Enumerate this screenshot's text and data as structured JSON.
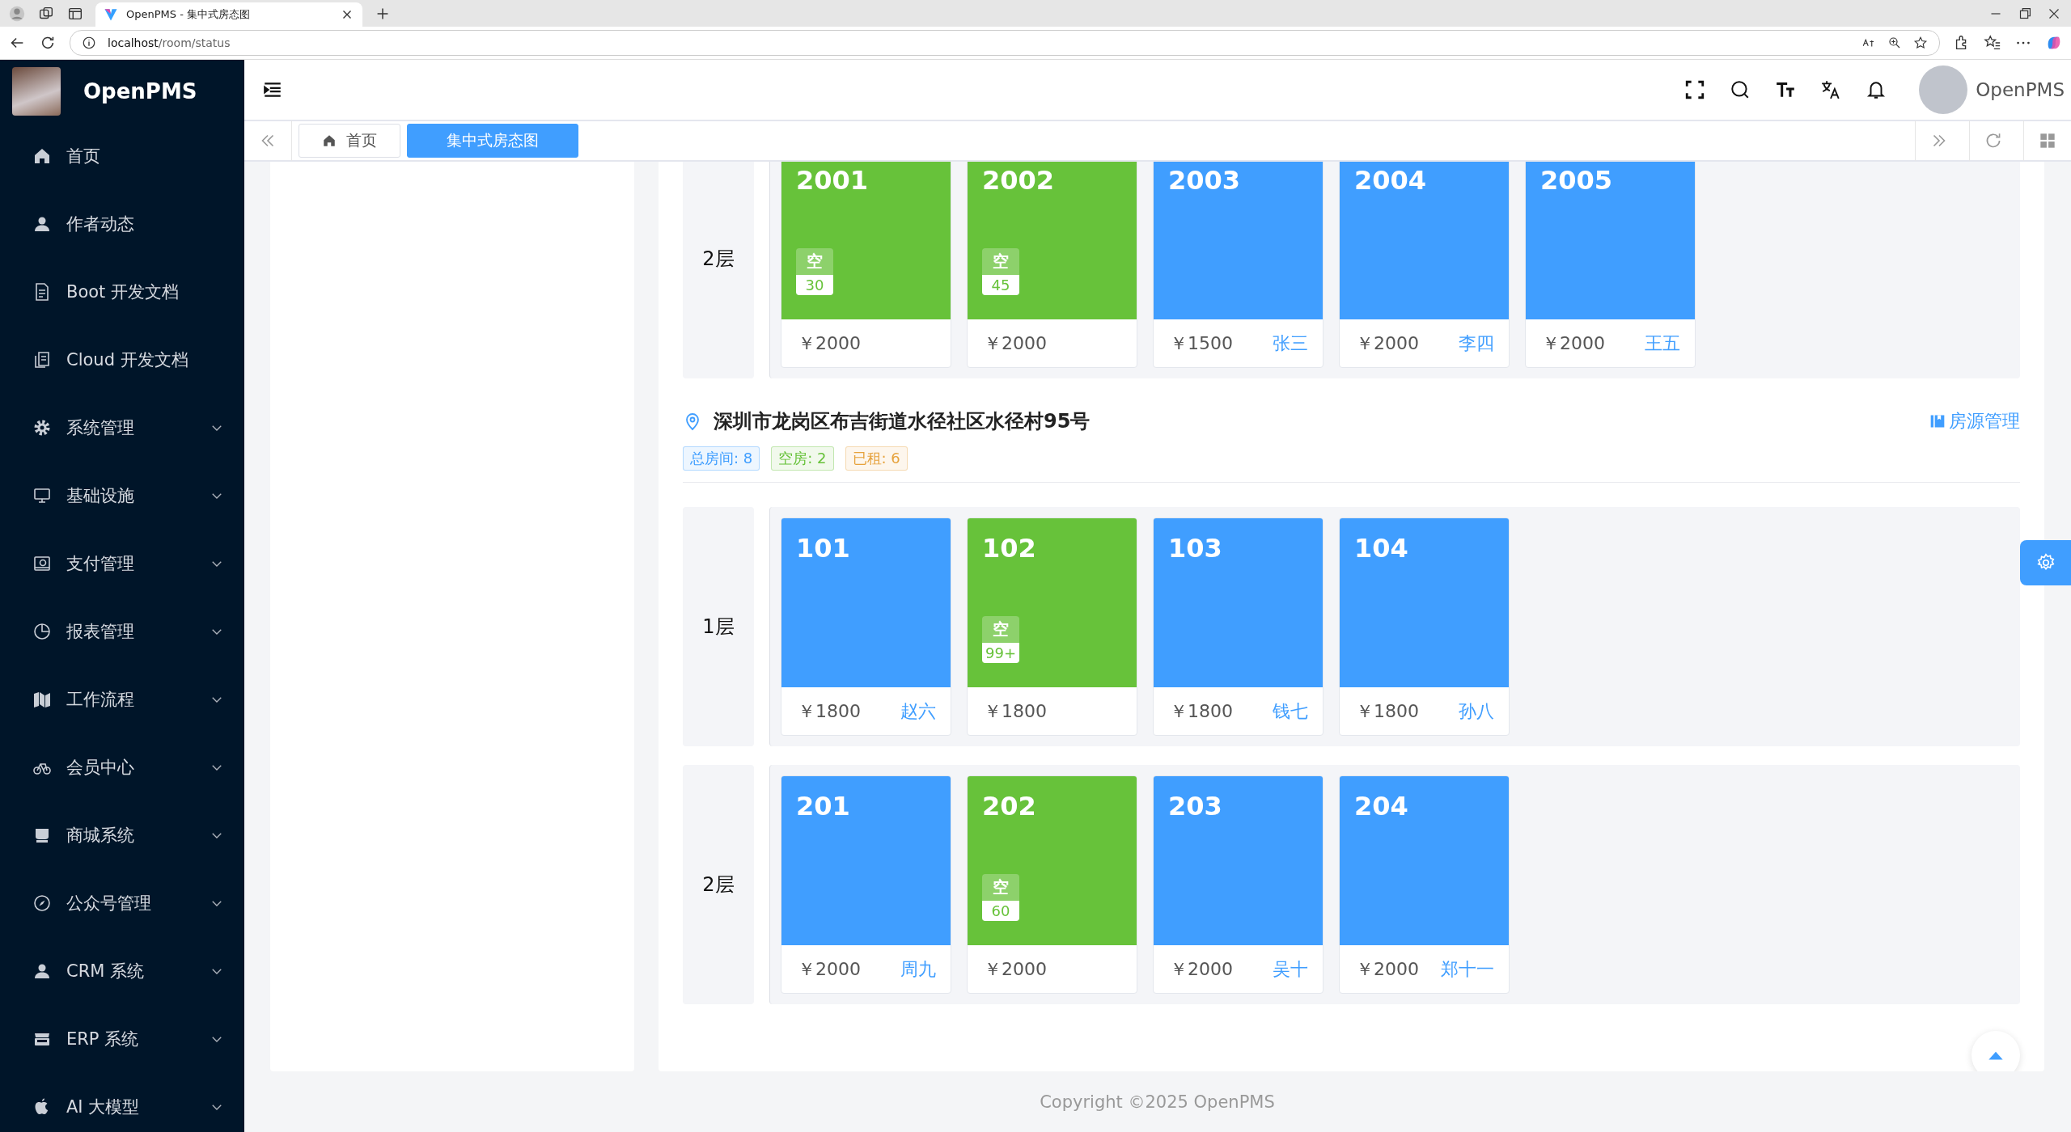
{
  "browser": {
    "tab_title": "OpenPMS - 集中式房态图",
    "url_host": "localhost",
    "url_path": "/room/status"
  },
  "sidebar": {
    "app_name": "OpenPMS",
    "items": [
      {
        "label": "首页",
        "expandable": false
      },
      {
        "label": "作者动态",
        "expandable": false
      },
      {
        "label": "Boot 开发文档",
        "expandable": false
      },
      {
        "label": "Cloud 开发文档",
        "expandable": false
      },
      {
        "label": "系统管理",
        "expandable": true
      },
      {
        "label": "基础设施",
        "expandable": true
      },
      {
        "label": "支付管理",
        "expandable": true
      },
      {
        "label": "报表管理",
        "expandable": true
      },
      {
        "label": "工作流程",
        "expandable": true
      },
      {
        "label": "会员中心",
        "expandable": true
      },
      {
        "label": "商城系统",
        "expandable": true
      },
      {
        "label": "公众号管理",
        "expandable": true
      },
      {
        "label": "CRM 系统",
        "expandable": true
      },
      {
        "label": "ERP 系统",
        "expandable": true
      },
      {
        "label": "AI 大模型",
        "expandable": true
      }
    ]
  },
  "header": {
    "user_name": "OpenPMS"
  },
  "tabs": [
    {
      "label": "首页",
      "selected": false
    },
    {
      "label": "集中式房态图",
      "selected": true
    }
  ],
  "buildings": [
    {
      "floors": [
        {
          "label": "2层",
          "rooms": [
            {
              "number": "2001",
              "kind": "vacant",
              "badge": "空",
              "days": "30",
              "price": "￥2000"
            },
            {
              "number": "2002",
              "kind": "vacant",
              "badge": "空",
              "days": "45",
              "price": "￥2000"
            },
            {
              "number": "2003",
              "kind": "rented",
              "price": "￥1500",
              "tenant": "张三"
            },
            {
              "number": "2004",
              "kind": "rented",
              "price": "￥2000",
              "tenant": "李四"
            },
            {
              "number": "2005",
              "kind": "rented",
              "price": "￥2000",
              "tenant": "王五"
            }
          ]
        }
      ]
    },
    {
      "address": "深圳市龙岗区布吉街道水径社区水径村95号",
      "manage_link": "房源管理",
      "tags": [
        {
          "label": "总房间: 8",
          "color": "#409eff"
        },
        {
          "label": "空房: 2",
          "color": "#67c23a"
        },
        {
          "label": "已租: 6",
          "color": "#e6a23c"
        }
      ],
      "floors": [
        {
          "label": "1层",
          "rooms": [
            {
              "number": "101",
              "kind": "rented",
              "price": "￥1800",
              "tenant": "赵六"
            },
            {
              "number": "102",
              "kind": "vacant",
              "badge": "空",
              "days": "99+",
              "price": "￥1800"
            },
            {
              "number": "103",
              "kind": "rented",
              "price": "￥1800",
              "tenant": "钱七"
            },
            {
              "number": "104",
              "kind": "rented",
              "price": "￥1800",
              "tenant": "孙八"
            }
          ]
        },
        {
          "label": "2层",
          "rooms": [
            {
              "number": "201",
              "kind": "rented",
              "price": "￥2000",
              "tenant": "周九"
            },
            {
              "number": "202",
              "kind": "vacant",
              "badge": "空",
              "days": "60",
              "price": "￥2000"
            },
            {
              "number": "203",
              "kind": "rented",
              "price": "￥2000",
              "tenant": "吴十"
            },
            {
              "number": "204",
              "kind": "rented",
              "price": "￥2000",
              "tenant": "郑十一"
            }
          ]
        }
      ]
    }
  ],
  "footer": {
    "copyright": "Copyright ©2025 OpenPMS"
  }
}
